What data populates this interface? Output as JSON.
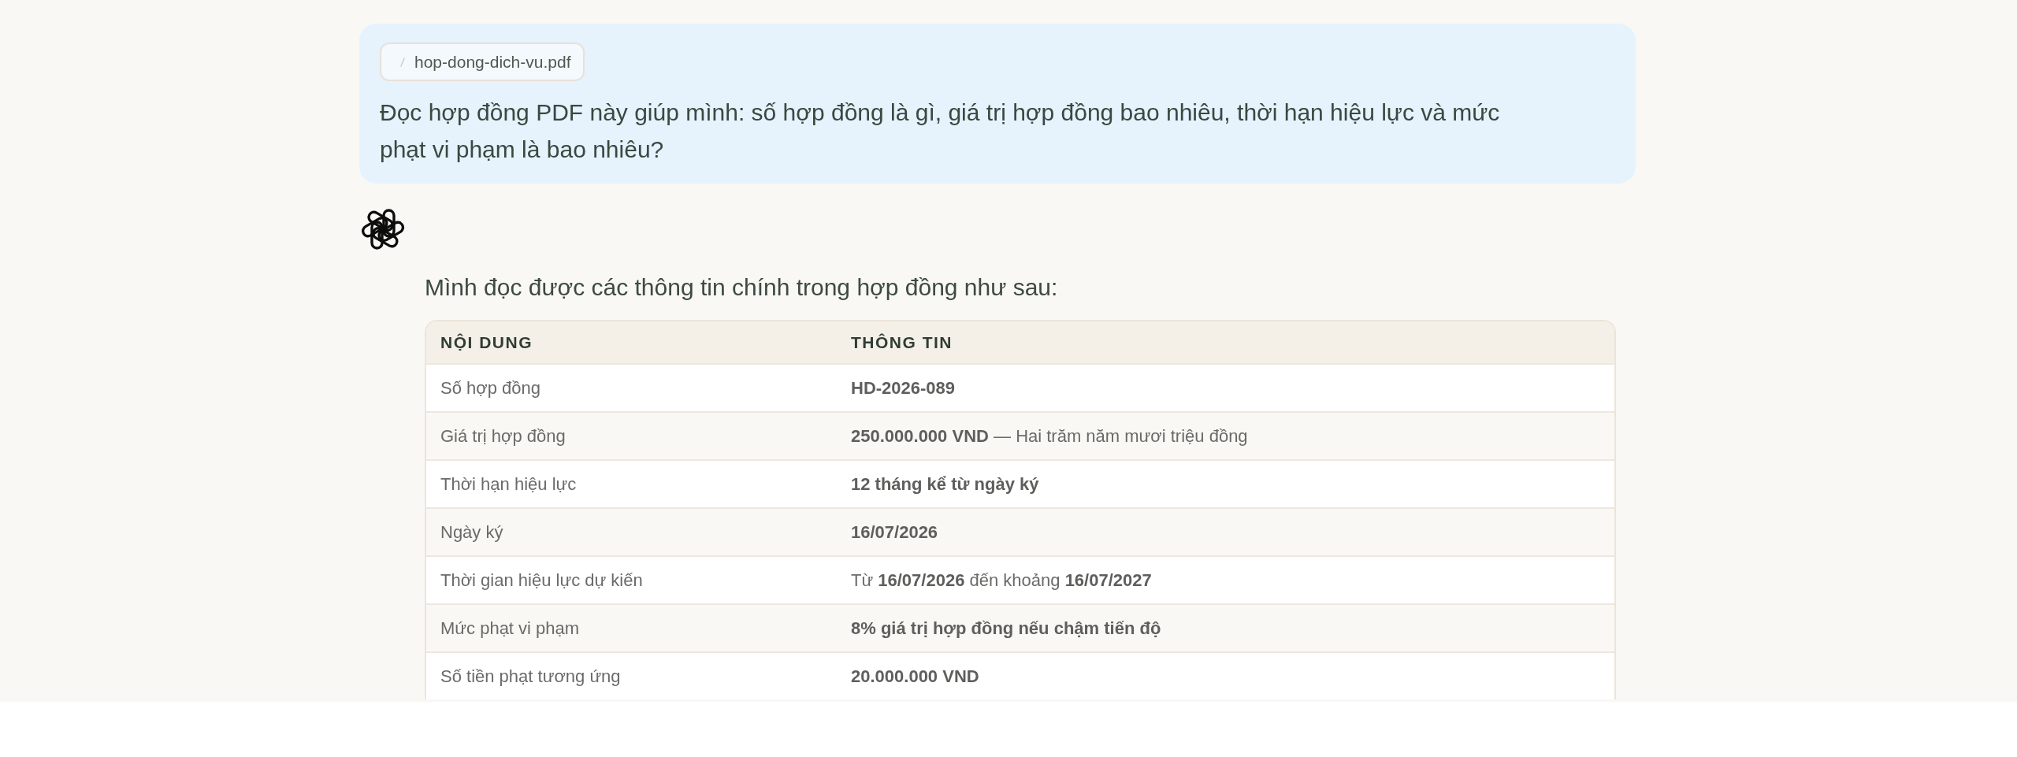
{
  "user_message": {
    "attachment": {
      "filename": "hop-dong-dich-vu.pdf"
    },
    "text": "Đọc hợp đồng PDF này giúp mình: số hợp đồng là gì, giá trị hợp đồng bao nhiêu, thời hạn hiệu lực và mức phạt vi phạm là bao nhiêu?"
  },
  "assistant_message": {
    "intro": "Mình đọc được các thông tin chính trong hợp đồng như sau:",
    "table": {
      "columns": [
        "NỘI DUNG",
        "THÔNG TIN"
      ],
      "rows": [
        {
          "label": "Số hợp đồng",
          "value": "HD-2026-089",
          "value_bold": true
        },
        {
          "label": "Giá trị hợp đồng",
          "value": "**250.000.000 VND** — Hai trăm năm mươi triệu đồng",
          "value_bold": false
        },
        {
          "label": "Thời hạn hiệu lực",
          "value": "12 tháng kể từ ngày ký",
          "value_bold": true
        },
        {
          "label": "Ngày ký",
          "value": "16/07/2026",
          "value_bold": true
        },
        {
          "label": "Thời gian hiệu lực dự kiến",
          "value": "Từ **16/07/2026** đến khoảng **16/07/2027**",
          "value_bold": false
        },
        {
          "label": "Mức phạt vi phạm",
          "value": "8% giá trị hợp đồng nếu chậm tiến độ",
          "value_bold": true
        },
        {
          "label": "Số tiền phạt tương ứng",
          "value": "20.000.000 VND",
          "value_bold": true
        }
      ]
    }
  }
}
